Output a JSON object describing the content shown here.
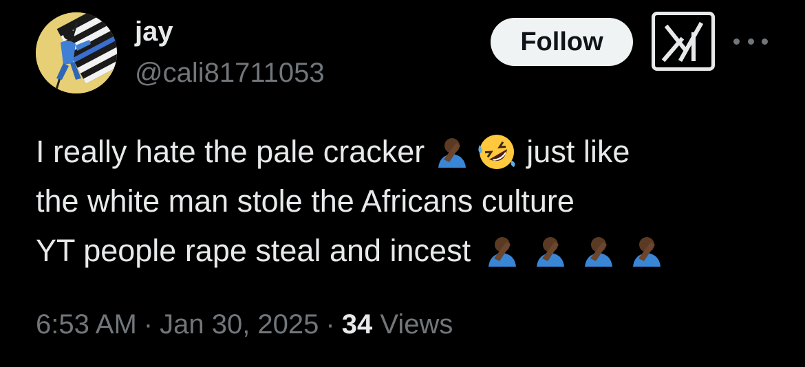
{
  "author": {
    "name": "jay",
    "handle": "@cali81711053"
  },
  "actions": {
    "follow_label": "Follow"
  },
  "icons": {
    "grok": "grok-icon",
    "more": "more-icon",
    "facepalm": "man-facepalming-dark-skin-emoji",
    "laughing": "rolling-on-floor-laughing-emoji"
  },
  "tweet": {
    "line1_text": "I really hate the pale cracker",
    "line1_tail": "just like",
    "line2": "the white man stole the Africans culture",
    "line3_text": "YT people rape steal and incest"
  },
  "meta": {
    "time": "6:53 AM",
    "separator": "·",
    "date": "Jan 30, 2025",
    "views_count": "34",
    "views_label": "Views"
  },
  "colors": {
    "background": "#000000",
    "primary_text": "#e7e9ea",
    "secondary_text": "#71767b",
    "follow_bg": "#eff3f4"
  }
}
